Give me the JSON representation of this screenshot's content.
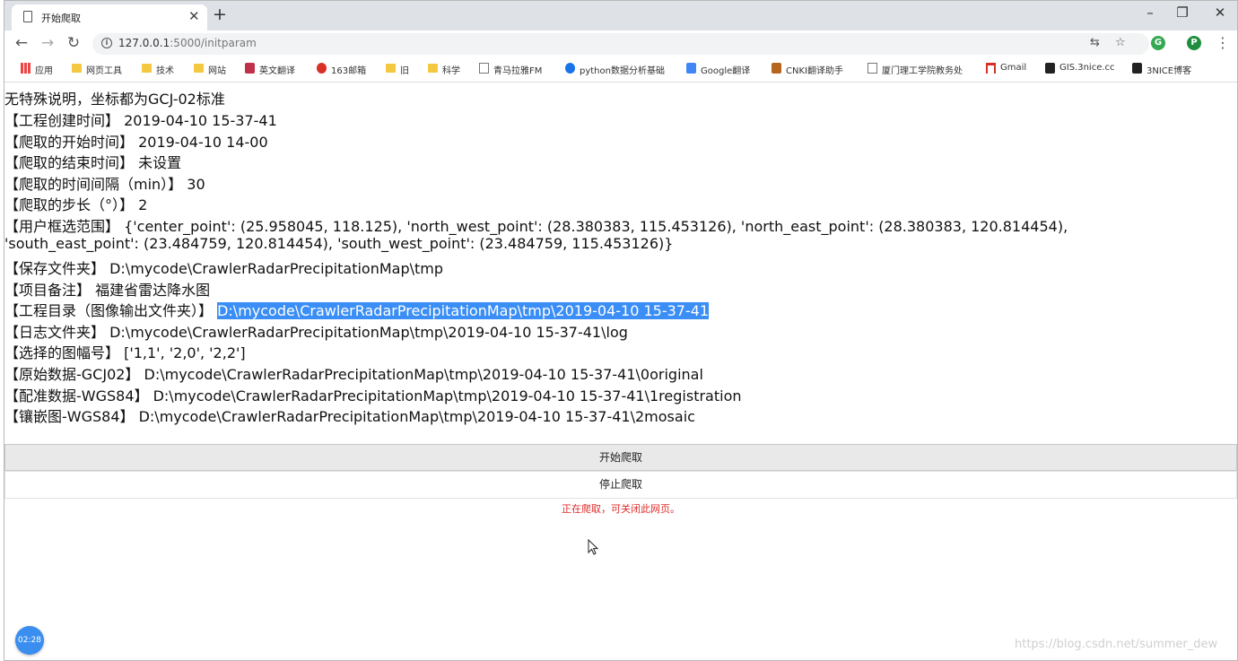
{
  "browser": {
    "tab_title": "开始爬取",
    "new_tab": "+",
    "url_host": "127.0.0.1",
    "url_rest": ":5000/initparam",
    "window_controls": [
      "–",
      "❐",
      "✕"
    ]
  },
  "bookmarks": [
    {
      "label": "应用",
      "icon": "apps-icon"
    },
    {
      "label": "网页工具",
      "icon": "folder-icon"
    },
    {
      "label": "技术",
      "icon": "folder-icon"
    },
    {
      "label": "网站",
      "icon": "folder-icon"
    },
    {
      "label": "英文翻译",
      "icon": "bookmark-icon"
    },
    {
      "label": "163邮箱",
      "icon": "mail-icon"
    },
    {
      "label": "旧",
      "icon": "folder-icon"
    },
    {
      "label": "科学",
      "icon": "folder-icon"
    },
    {
      "label": "青马拉雅FM",
      "icon": "page-icon"
    },
    {
      "label": "python数据分析基础",
      "icon": "globe-icon"
    },
    {
      "label": "Google翻译",
      "icon": "translate-icon"
    },
    {
      "label": "CNKI翻译助手",
      "icon": "cnki-icon"
    },
    {
      "label": "厦门理工学院教务处",
      "icon": "page-icon"
    },
    {
      "label": "Gmail",
      "icon": "gmail-icon"
    },
    {
      "label": "GIS.3nice.cc",
      "icon": "gis-icon"
    },
    {
      "label": "3NICE博客",
      "icon": "blog-icon"
    }
  ],
  "info": {
    "note": "无特殊说明，坐标都为GCJ-02标准",
    "create_time": "【工程创建时间】 2019-04-10 15-37-41",
    "start_time": "【爬取的开始时间】 2019-04-10 14-00",
    "end_time": "【爬取的结束时间】 未设置",
    "interval": "【爬取的时间间隔（min）】 30",
    "step": "【爬取的步长（°）】 2",
    "range_line1": "【用户框选范围】 {'center_point': (25.958045, 118.125), 'north_west_point': (28.380383, 115.453126), 'north_east_point': (28.380383, 120.814454),",
    "range_line2": "'south_east_point': (23.484759, 120.814454), 'south_west_point': (23.484759, 115.453126)}",
    "save_folder": "【保存文件夹】 D:\\mycode\\CrawlerRadarPrecipitationMap\\tmp",
    "remark": "【项目备注】 福建省雷达降水图",
    "project_dir_label": "【工程目录（图像输出文件夹）】 ",
    "project_dir_value": "D:\\mycode\\CrawlerRadarPrecipitationMap\\tmp\\2019-04-10 15-37-41",
    "log_folder": "【日志文件夹】 D:\\mycode\\CrawlerRadarPrecipitationMap\\tmp\\2019-04-10 15-37-41\\log",
    "map_numbers": "【选择的图幅号】 ['1,1', '2,0', '2,2']",
    "original": "【原始数据-GCJ02】 D:\\mycode\\CrawlerRadarPrecipitationMap\\tmp\\2019-04-10 15-37-41\\0original",
    "registration": "【配准数据-WGS84】 D:\\mycode\\CrawlerRadarPrecipitationMap\\tmp\\2019-04-10 15-37-41\\1registration",
    "mosaic": "【镶嵌图-WGS84】 D:\\mycode\\CrawlerRadarPrecipitationMap\\tmp\\2019-04-10 15-37-41\\2mosaic"
  },
  "actions": {
    "start_label": "开始爬取",
    "stop_label": "停止爬取",
    "status_text": "正在爬取，可关闭此网页。"
  },
  "overlay": {
    "timer": "02:28",
    "watermark": "https://blog.csdn.net/summer_dew"
  },
  "colors": {
    "selection": "#3b8ef5",
    "status": "#e02b2b",
    "timer_badge": "#3a8ef0"
  }
}
